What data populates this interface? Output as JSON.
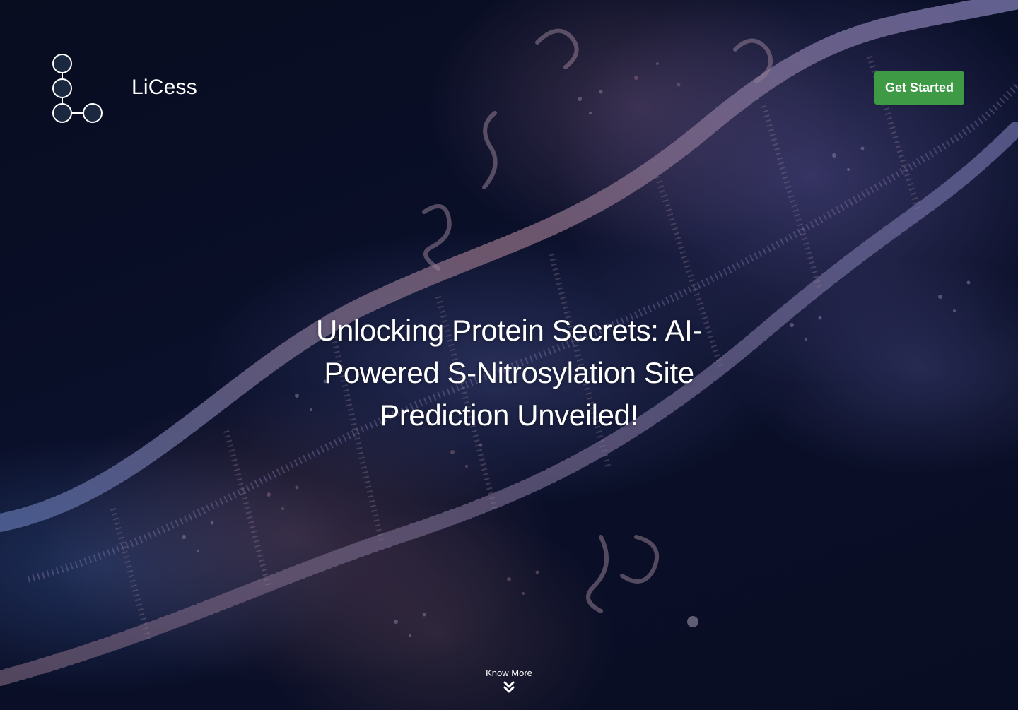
{
  "brand": {
    "name": "LiCess",
    "logo_icon": "molecule-nodes-icon"
  },
  "header": {
    "cta_label": "Get Started"
  },
  "hero": {
    "headline": "Unlocking Protein Secrets: AI-Powered S-Nitrosylation Site Prediction Unveiled!",
    "background_icon": "dna-particles-image"
  },
  "scroll_hint": {
    "label": "Know More",
    "icon": "double-chevron-down-icon"
  },
  "colors": {
    "accent": "#3f9a45",
    "background": "#0a0f22",
    "text": "#ffffff"
  }
}
